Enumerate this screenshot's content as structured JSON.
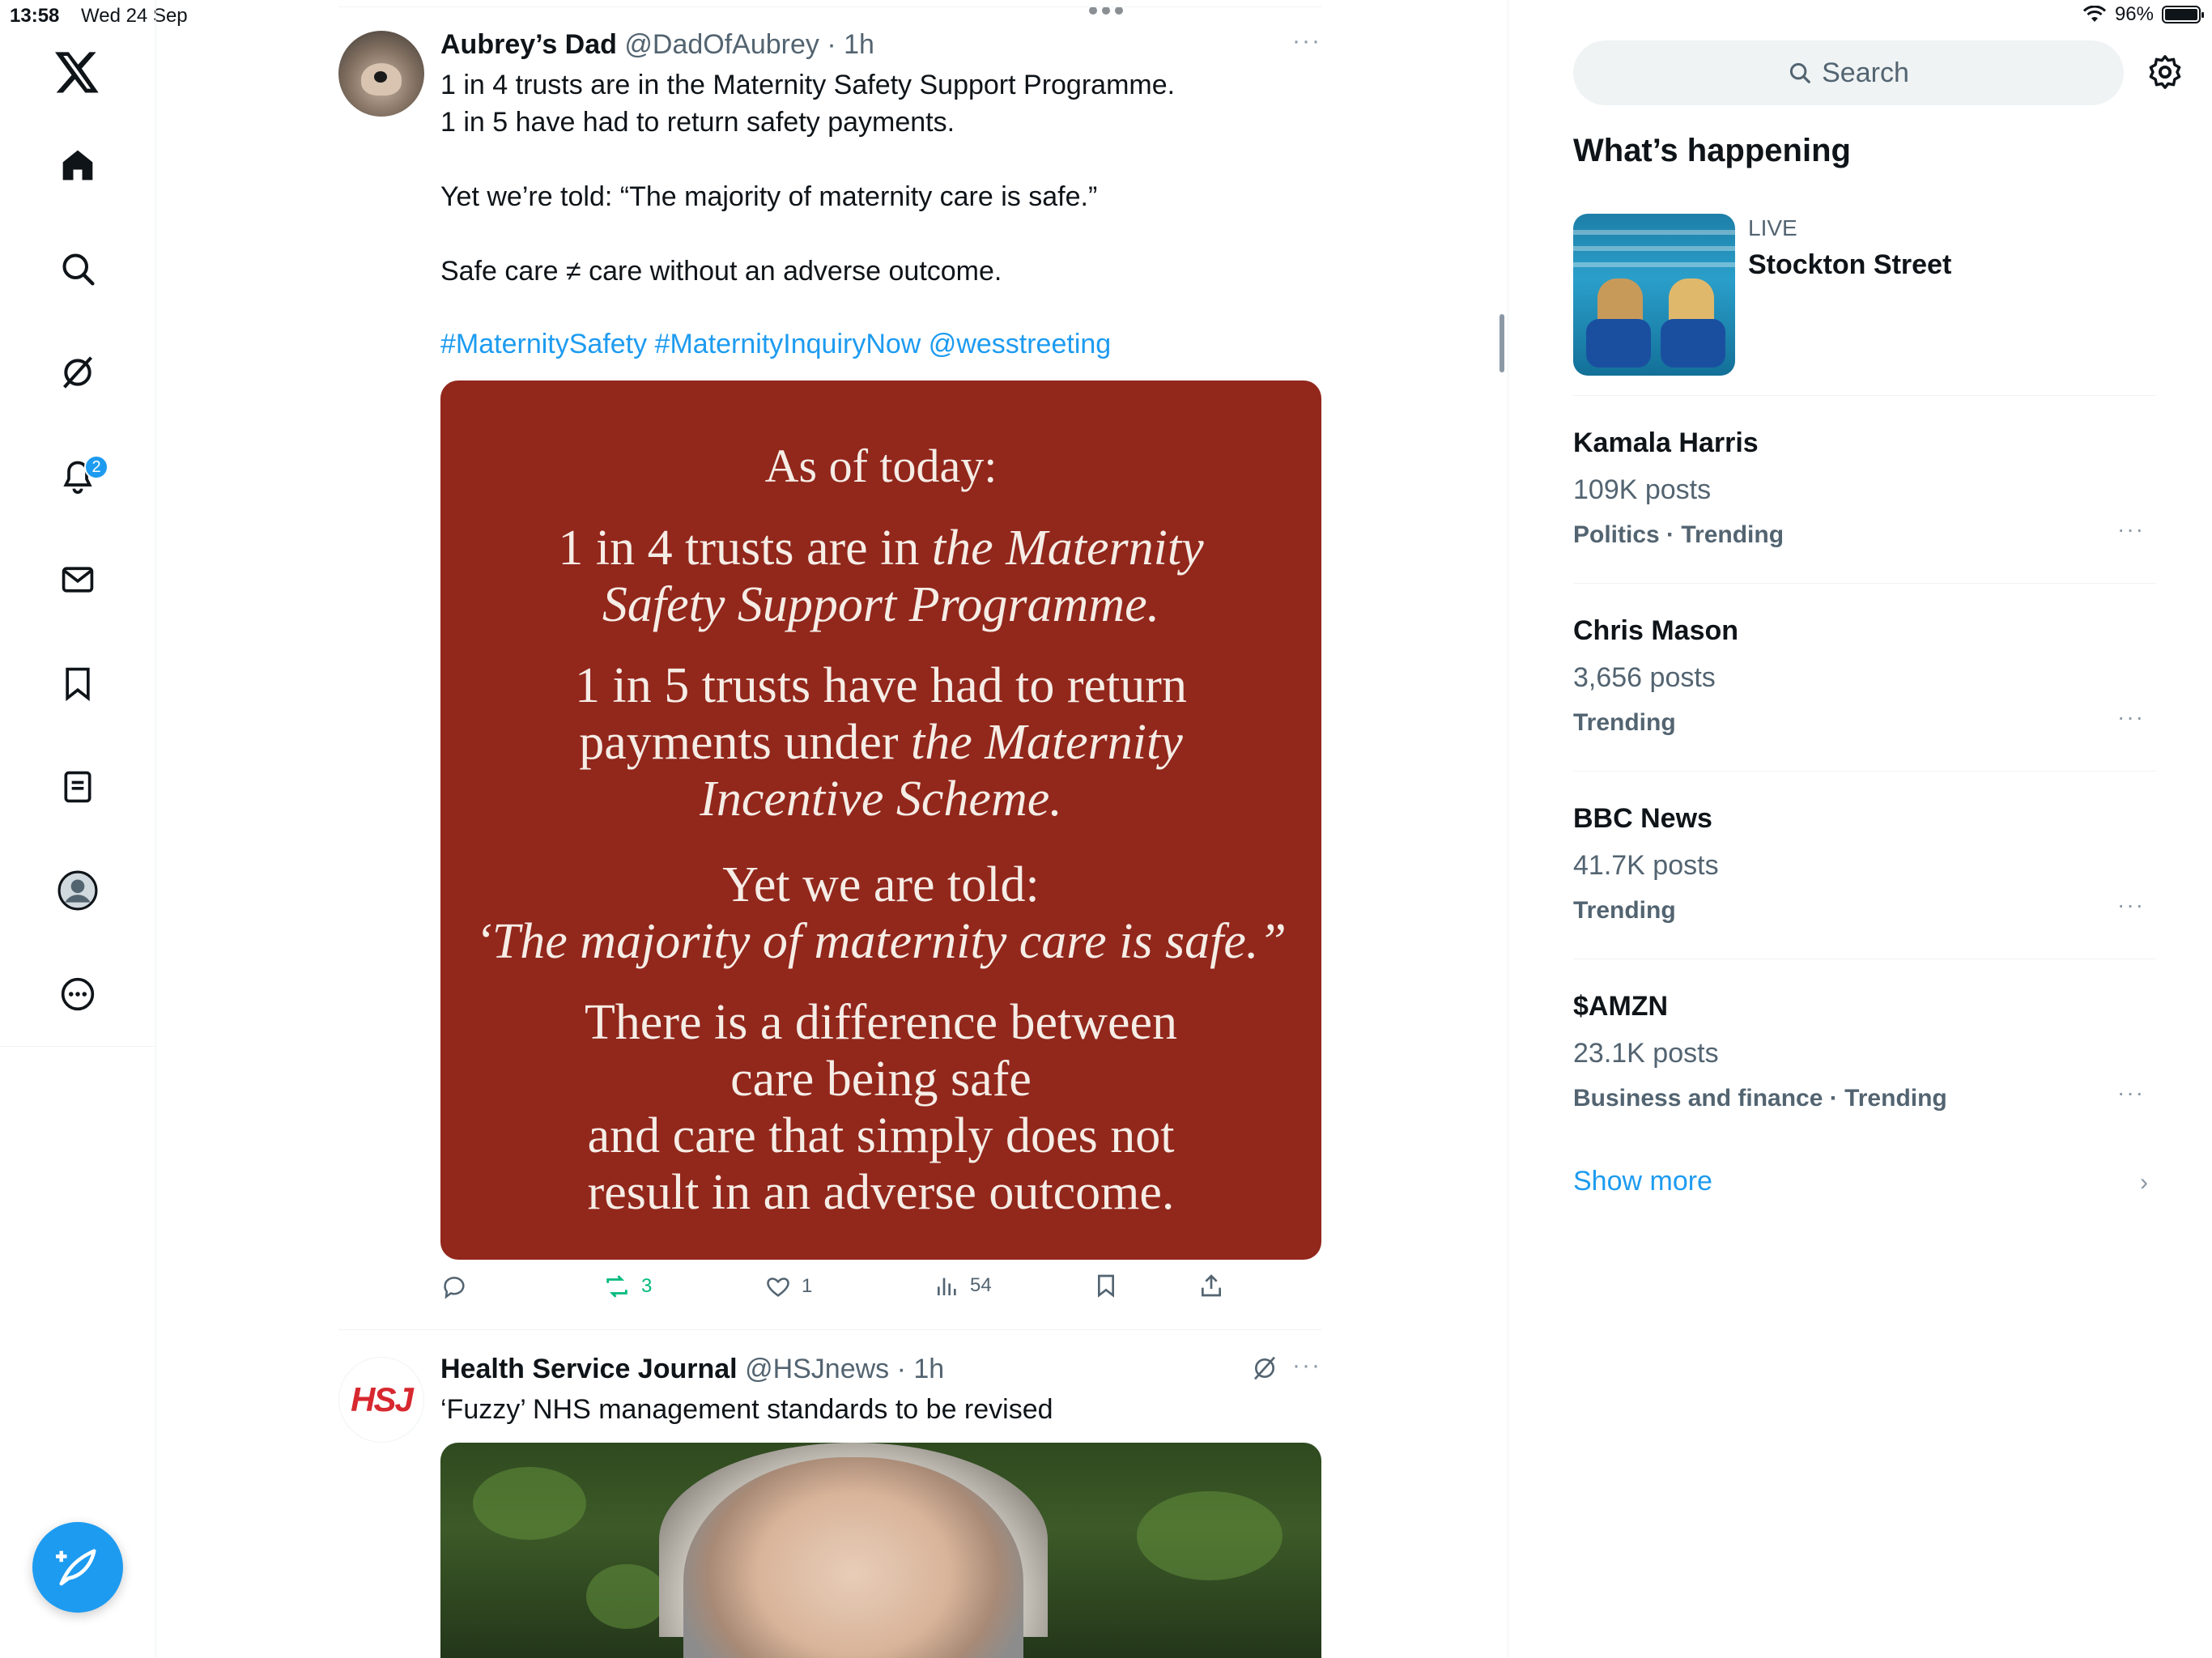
{
  "status_bar": {
    "time": "13:58",
    "date": "Wed 24 Sep",
    "battery_text": "96%",
    "battery_level": 0.96
  },
  "nav": {
    "items": [
      "x-logo",
      "home",
      "explore",
      "grok",
      "notifications",
      "messages",
      "bookmarks",
      "lists",
      "profile",
      "more"
    ],
    "notifications_badge": "2"
  },
  "feed": {
    "post1": {
      "name": "Aubrey’s Dad",
      "handle": "@DadOfAubrey · 1h",
      "lines": [
        "1 in 4 trusts are in the Maternity Safety Support Programme.",
        "1 in 5 have had to return safety payments.",
        "Yet we’re told: “The majority of maternity care is safe.”",
        "Safe care ≠ care without an adverse outcome."
      ],
      "links": "#MaternitySafety #MaternityInquiryNow @wesstreeting",
      "card": {
        "l1": "As of today:",
        "l2a": "1 in 4 trusts are in ",
        "l2b": "the Maternity",
        "l2c": "Safety Support Programme.",
        "l3a": "1 in 5 trusts have had to return",
        "l3b": "payments under ",
        "l3c": "the Maternity",
        "l3d": "Incentive Scheme.",
        "l4a": "Yet we are told:",
        "l4b": "‘The majority of maternity care is safe.”",
        "l5a": "There is a difference between",
        "l5b": "care being safe",
        "l5c": "and care that simply does not",
        "l5d": "result in an adverse outcome."
      },
      "actions": {
        "reposts": "3",
        "likes": "1",
        "views": "54"
      }
    },
    "post2": {
      "name": "Health Service Journal",
      "handle": "@HSJnews · 1h",
      "avatar_text": "HSJ",
      "text": "‘Fuzzy’ NHS management standards to be revised"
    }
  },
  "sidebar": {
    "search_placeholder": "Search",
    "heading": "What’s happening",
    "live": {
      "label": "LIVE",
      "title": "Stockton Street"
    },
    "trends": [
      {
        "name": "Kamala Harris",
        "posts": "109K posts",
        "category": "Politics · Trending"
      },
      {
        "name": "Chris Mason",
        "posts": "3,656 posts",
        "category": "Trending"
      },
      {
        "name": "BBC News",
        "posts": "41.7K posts",
        "category": "Trending"
      },
      {
        "name": "$AMZN",
        "posts": "23.1K posts",
        "category": "Business and finance · Trending"
      }
    ],
    "show_more": "Show more"
  },
  "colors": {
    "accent": "#1d9bf0",
    "card_bg": "#92271c",
    "repost_green": "#00ba7c"
  }
}
